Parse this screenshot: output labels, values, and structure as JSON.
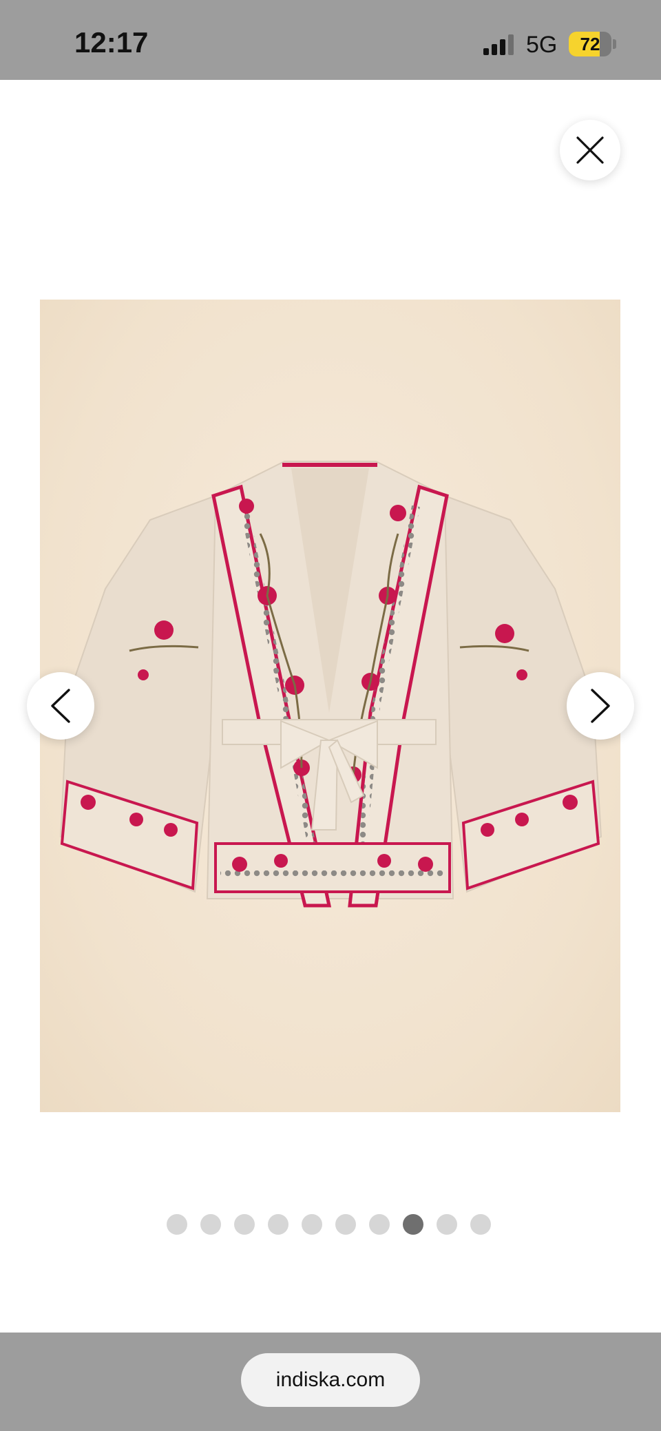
{
  "status_bar": {
    "time": "12:17",
    "network": "5G",
    "battery_level": "72",
    "battery_fraction": 0.72,
    "signal_bars_active": 3,
    "signal_bars_total": 4
  },
  "icons": {
    "close": "close-icon",
    "previous": "chevron-left-icon",
    "next": "chevron-right-icon",
    "signal": "cellular-signal-icon",
    "battery": "battery-icon"
  },
  "gallery": {
    "image_count": 10,
    "active_index": 7
  },
  "browser": {
    "url": "indiska.com"
  },
  "colors": {
    "status_bg": "#9d9d9d",
    "battery_fill": "#f6d32d",
    "dot_inactive": "#d6d6d6",
    "dot_active": "#6f6f6f",
    "embroidery": "#c8174f"
  }
}
